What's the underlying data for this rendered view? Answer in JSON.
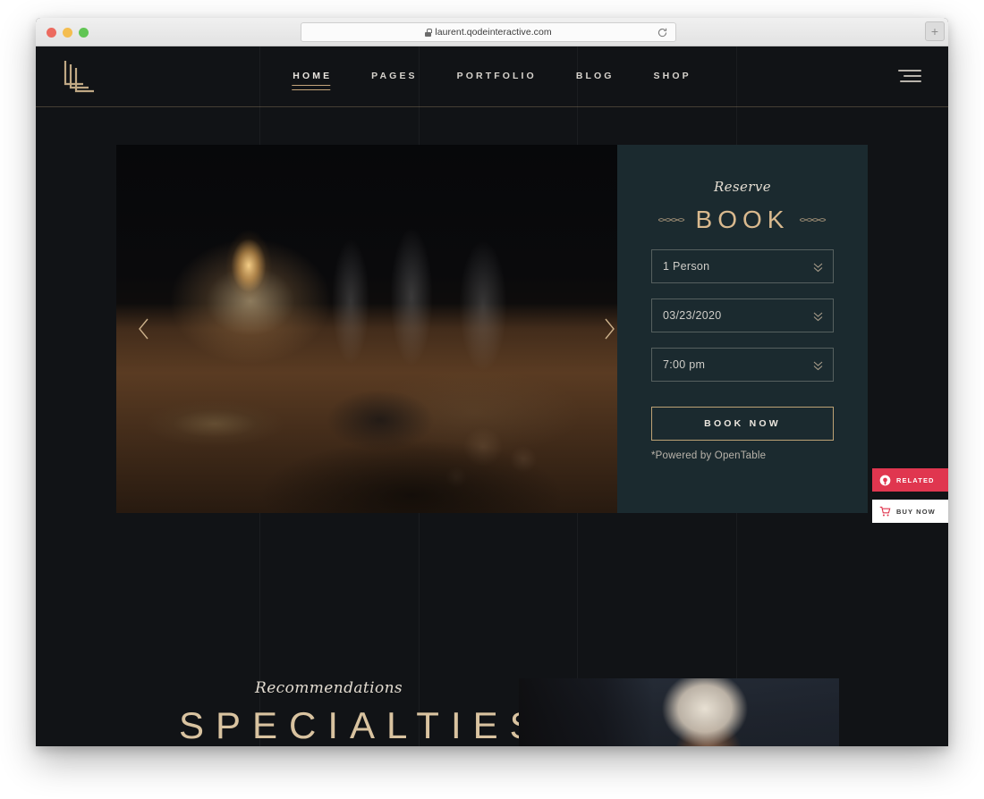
{
  "browser": {
    "url": "laurent.qodeinteractive.com",
    "lock_icon": "lock-icon",
    "reload_icon": "reload-icon",
    "new_tab_label": "+",
    "traffic_lights": [
      "close",
      "minimize",
      "zoom"
    ]
  },
  "header": {
    "logo_name": "laurent-logo",
    "nav": [
      {
        "label": "HOME",
        "active": true
      },
      {
        "label": "PAGES",
        "active": false
      },
      {
        "label": "PORTFOLIO",
        "active": false
      },
      {
        "label": "BLOG",
        "active": false
      },
      {
        "label": "SHOP",
        "active": false
      }
    ],
    "hamburger_icon": "hamburger-menu-icon"
  },
  "hero": {
    "prev_icon": "chevron-left-icon",
    "next_icon": "chevron-right-icon",
    "image_alt": "candlelit dinner table with wine glasses"
  },
  "booking": {
    "eyebrow": "Reserve",
    "title": "BOOK",
    "ornament_icon": "flourish-ornament-icon",
    "fields": [
      {
        "name": "party-size",
        "value": "1 Person",
        "icon": "chevron-double-down-icon"
      },
      {
        "name": "date",
        "value": "03/23/2020",
        "icon": "chevron-double-down-icon"
      },
      {
        "name": "time",
        "value": "7:00 pm",
        "icon": "chevron-double-down-icon"
      }
    ],
    "submit_label": "BOOK NOW",
    "powered_by": "*Powered by OpenTable",
    "panel_color": "#1b2a2f",
    "accent_color": "#d9b98e"
  },
  "side_widgets": [
    {
      "label": "RELATED",
      "icon": "qode-circle-icon",
      "bg": "#e0364f",
      "fg": "#ffffff"
    },
    {
      "label": "BUY NOW",
      "icon": "shopping-cart-icon",
      "bg": "#ffffff",
      "fg": "#3a3a3a"
    }
  ],
  "specialties": {
    "eyebrow": "Recommendations",
    "title": "SPECIALTIES",
    "image_alt": "chef in white toque preparing food"
  },
  "theme": {
    "page_bg": "#111316",
    "gold": "#c4a47b",
    "text_light": "#d7d3cd"
  }
}
